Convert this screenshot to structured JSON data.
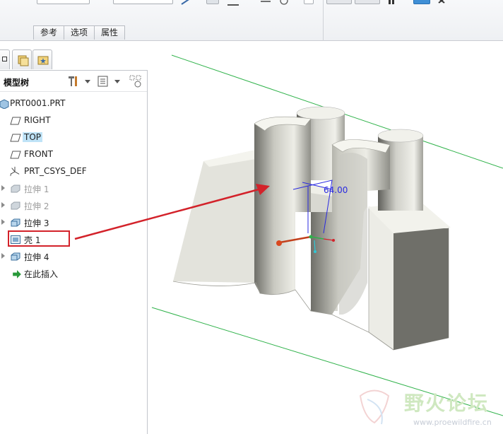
{
  "ribbon": {
    "subtabs": [
      "参考",
      "选项",
      "属性"
    ]
  },
  "navigator": {
    "tabs": [
      "model-tree-tab",
      "folder-browser-tab",
      "favorites-tab"
    ]
  },
  "model_tree": {
    "title": "模型树",
    "items": [
      {
        "label": "PRT0001.PRT",
        "icon": "part-icon",
        "state": "normal"
      },
      {
        "label": "RIGHT",
        "icon": "datum-plane-icon",
        "state": "normal"
      },
      {
        "label": "TOP",
        "icon": "datum-plane-icon",
        "state": "selected"
      },
      {
        "label": "FRONT",
        "icon": "datum-plane-icon",
        "state": "normal"
      },
      {
        "label": "PRT_CSYS_DEF",
        "icon": "csys-icon",
        "state": "normal"
      },
      {
        "label": "拉伸 1",
        "icon": "extrude-icon",
        "state": "suppressed"
      },
      {
        "label": "拉伸 2",
        "icon": "extrude-icon",
        "state": "suppressed"
      },
      {
        "label": "拉伸 3",
        "icon": "extrude-icon",
        "state": "normal"
      },
      {
        "label": "壳 1",
        "icon": "shell-icon",
        "state": "highlighted"
      },
      {
        "label": "拉伸 4",
        "icon": "extrude-icon",
        "state": "normal"
      },
      {
        "label": "在此插入",
        "icon": "insert-arrow-icon",
        "state": "normal"
      }
    ]
  },
  "viewport": {
    "dimension_label": "64.00"
  },
  "watermark": {
    "site_name": "野火论坛",
    "url": "www.proewildfire.cn"
  },
  "colors": {
    "highlight_box": "#d3222a",
    "selection": "#bfe3f7",
    "datum_outline": "#2fb24a",
    "dimension": "#2a2ae0",
    "arrow": "#d3222a"
  }
}
